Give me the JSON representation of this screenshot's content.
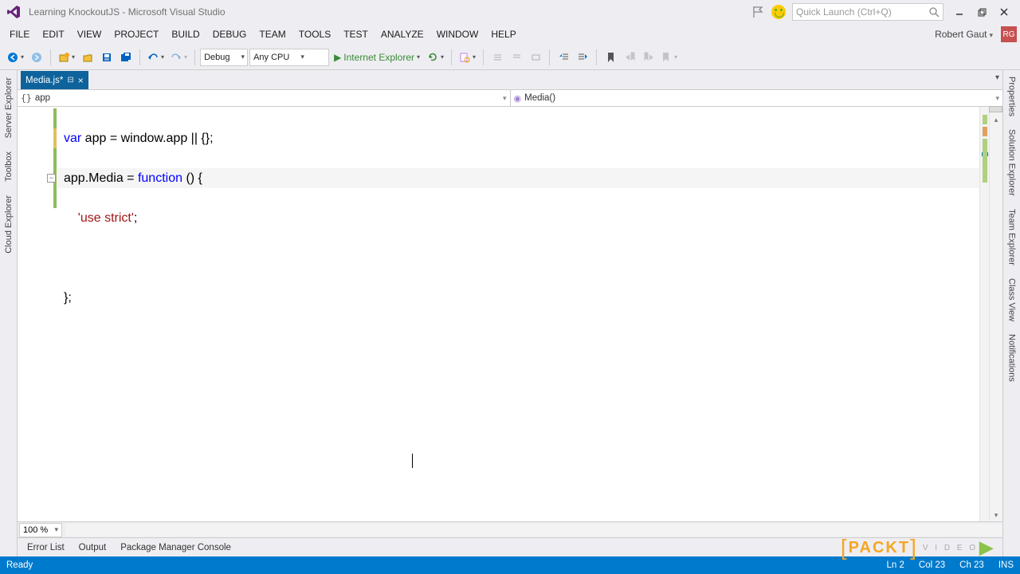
{
  "titlebar": {
    "title": "Learning KnockoutJS - Microsoft Visual Studio",
    "quick_placeholder": "Quick Launch (Ctrl+Q)"
  },
  "menubar": {
    "items": [
      "FILE",
      "EDIT",
      "VIEW",
      "PROJECT",
      "BUILD",
      "DEBUG",
      "TEAM",
      "TOOLS",
      "TEST",
      "ANALYZE",
      "WINDOW",
      "HELP"
    ],
    "user": "Robert Gaut",
    "user_initials": "RG"
  },
  "toolbar": {
    "config": "Debug",
    "platform": "Any CPU",
    "run_label": "Internet Explorer"
  },
  "leftdock": [
    "Server Explorer",
    "Toolbox",
    "Cloud Explorer"
  ],
  "rightdock": [
    "Properties",
    "Solution Explorer",
    "Team Explorer",
    "Class View",
    "Notifications"
  ],
  "doctab": {
    "name": "Media.js*",
    "pinned": true
  },
  "navbar": {
    "scope": "app",
    "member": "Media()"
  },
  "code": {
    "line1_pre": "var",
    "line1_mid": " app = window.app || {};",
    "line2_pre": "app.Media = ",
    "line2_kw": "function",
    "line2_post": " () {",
    "line3_indent": "    ",
    "line3_str": "'use strict'",
    "line3_post": ";",
    "line4": "",
    "line5": "};"
  },
  "zoom": "100 %",
  "bottomtabs": [
    "Error List",
    "Output",
    "Package Manager Console"
  ],
  "status": {
    "ready": "Ready",
    "ln": "Ln 2",
    "col": "Col 23",
    "ch": "Ch 23",
    "ins": "INS"
  },
  "watermark": {
    "brand": "PACKT",
    "sub": "V I D E O"
  }
}
